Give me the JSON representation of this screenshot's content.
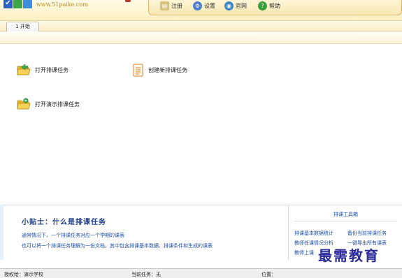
{
  "header": {
    "site_url": "www.51paike.com",
    "toolbar": [
      {
        "label": "注册",
        "icon": "register-icon"
      },
      {
        "label": "设置",
        "icon": "gear-icon"
      },
      {
        "label": "官网",
        "icon": "globe-icon"
      },
      {
        "label": "帮助",
        "icon": "help-icon"
      }
    ]
  },
  "tabs": [
    {
      "label": "1 开始"
    }
  ],
  "actions": {
    "open_task": "打开排课任务",
    "create_task": "创建新排课任务",
    "open_demo_task": "打开演示排课任务"
  },
  "tip": {
    "title": "小贴士：什么是排课任务",
    "line1": "通常情况下，一个排课任务对应一个学期的课表",
    "line2": "也可以将一个排课任务理解为一份文档，其中包含排课基本数据、排课条件和生成的课表"
  },
  "tools": {
    "title": "排课工具箱",
    "links": [
      "排课基本数据统计",
      "备份当前排课任务",
      "教师任课情况分析",
      "一键导出所有课表",
      "教师上课"
    ]
  },
  "status": {
    "licensee": "授权给：演示学校",
    "current_task": "当前任务：无",
    "location": "位置："
  },
  "watermark": "最需教育",
  "colors": {
    "link_blue": "#1f4fa8",
    "title_blue": "#1f3f8c",
    "header_gold": "#fdf0c2",
    "folder_yellow": "#f3c433",
    "folder_green_arrow": "#3aa84a"
  }
}
